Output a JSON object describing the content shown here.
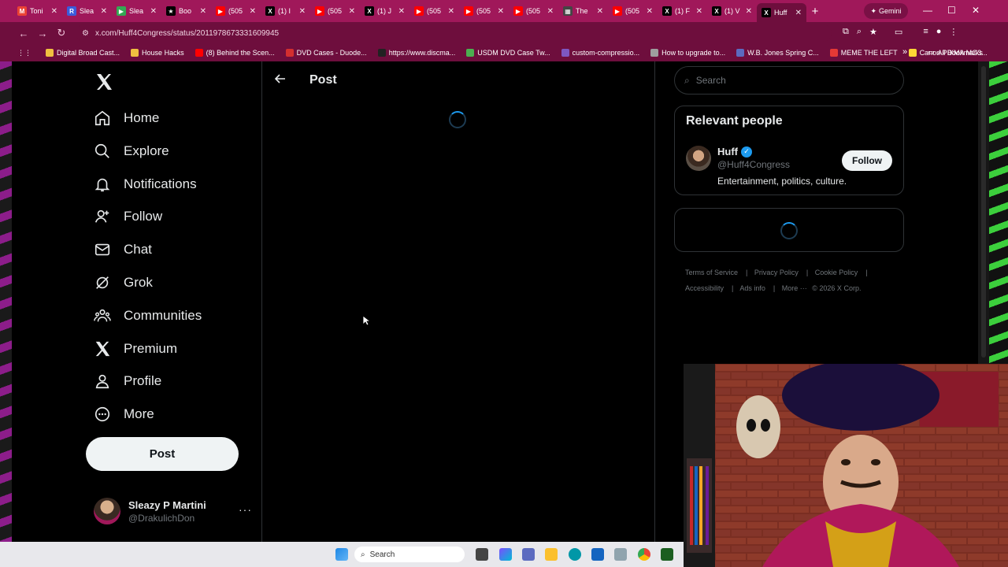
{
  "browser": {
    "tabs": [
      {
        "title": "Toni",
        "icon": "gmail-icon",
        "color": "#ea4335",
        "glyph": "M"
      },
      {
        "title": "Slea",
        "icon": "r-icon",
        "color": "#3b5bdb",
        "glyph": "R"
      },
      {
        "title": "Slea",
        "icon": "play-icon",
        "color": "#34a853",
        "glyph": "▶"
      },
      {
        "title": "Boo",
        "icon": "star-icon",
        "color": "#000000",
        "glyph": "★"
      },
      {
        "title": "(505",
        "icon": "youtube-icon",
        "color": "#ff0000",
        "glyph": "▶"
      },
      {
        "title": "(1) I",
        "icon": "x-icon",
        "color": "#000000",
        "glyph": "X"
      },
      {
        "title": "(505",
        "icon": "youtube-icon",
        "color": "#ff0000",
        "glyph": "▶"
      },
      {
        "title": "(1) J",
        "icon": "x-icon",
        "color": "#000000",
        "glyph": "X"
      },
      {
        "title": "(505",
        "icon": "youtube-icon",
        "color": "#ff0000",
        "glyph": "▶"
      },
      {
        "title": "(505",
        "icon": "youtube-icon",
        "color": "#ff0000",
        "glyph": "▶"
      },
      {
        "title": "(505",
        "icon": "youtube-icon",
        "color": "#ff0000",
        "glyph": "▶"
      },
      {
        "title": "The",
        "icon": "news-icon",
        "color": "#444444",
        "glyph": "▦"
      },
      {
        "title": "(505",
        "icon": "youtube-icon",
        "color": "#ff0000",
        "glyph": "▶"
      },
      {
        "title": "(1) F",
        "icon": "x-icon",
        "color": "#000000",
        "glyph": "X"
      },
      {
        "title": "(1) V",
        "icon": "x-icon",
        "color": "#000000",
        "glyph": "X"
      },
      {
        "title": "Huff",
        "icon": "x-icon",
        "color": "#000000",
        "glyph": "X",
        "active": true
      }
    ],
    "gemini_label": "Gemini",
    "url": "x.com/Huff4Congress/status/2011978673331609945",
    "bookmarks": [
      {
        "label": "Digital Broad Cast...",
        "color": "#f0c040"
      },
      {
        "label": "House Hacks",
        "color": "#f0c040"
      },
      {
        "label": "(8) Behind the Scen...",
        "color": "#ff0000"
      },
      {
        "label": "DVD Cases - Duode...",
        "color": "#d32f2f"
      },
      {
        "label": "https://www.discma...",
        "color": "#222222"
      },
      {
        "label": "USDM DVD Case Tw...",
        "color": "#4caf50"
      },
      {
        "label": "custom-compressio...",
        "color": "#7e57c2"
      },
      {
        "label": "How to upgrade to...",
        "color": "#9e9e9e"
      },
      {
        "label": "W.B. Jones Spring C...",
        "color": "#5c6bc0"
      },
      {
        "label": "MEME THE LEFT",
        "color": "#e53935"
      },
      {
        "label": "Canon PIXMA MG3...",
        "color": "#fdd835"
      }
    ],
    "all_bookmarks": "All Bookmarks"
  },
  "sidebar": {
    "items": [
      {
        "label": "Home",
        "icon": "home-icon"
      },
      {
        "label": "Explore",
        "icon": "search-icon"
      },
      {
        "label": "Notifications",
        "icon": "bell-icon"
      },
      {
        "label": "Follow",
        "icon": "person-add-icon"
      },
      {
        "label": "Chat",
        "icon": "mail-icon"
      },
      {
        "label": "Grok",
        "icon": "grok-icon"
      },
      {
        "label": "Communities",
        "icon": "communities-icon"
      },
      {
        "label": "Premium",
        "icon": "x-premium-icon"
      },
      {
        "label": "Profile",
        "icon": "person-icon"
      },
      {
        "label": "More",
        "icon": "more-circle-icon"
      }
    ],
    "post_label": "Post",
    "account": {
      "name": "Sleazy P Martini",
      "handle": "@DrakulichDon"
    }
  },
  "main": {
    "title": "Post"
  },
  "right": {
    "search_placeholder": "Search",
    "relevant_title": "Relevant people",
    "person": {
      "name": "Huff",
      "handle": "@Huff4Congress",
      "bio": "Entertainment, politics, culture.",
      "follow_label": "Follow"
    },
    "footer": {
      "terms": "Terms of Service",
      "privacy": "Privacy Policy",
      "cookie": "Cookie Policy",
      "accessibility": "Accessibility",
      "ads": "Ads info",
      "more": "More ···",
      "copyright": "© 2026 X Corp."
    }
  },
  "taskbar": {
    "search_label": "Search"
  }
}
